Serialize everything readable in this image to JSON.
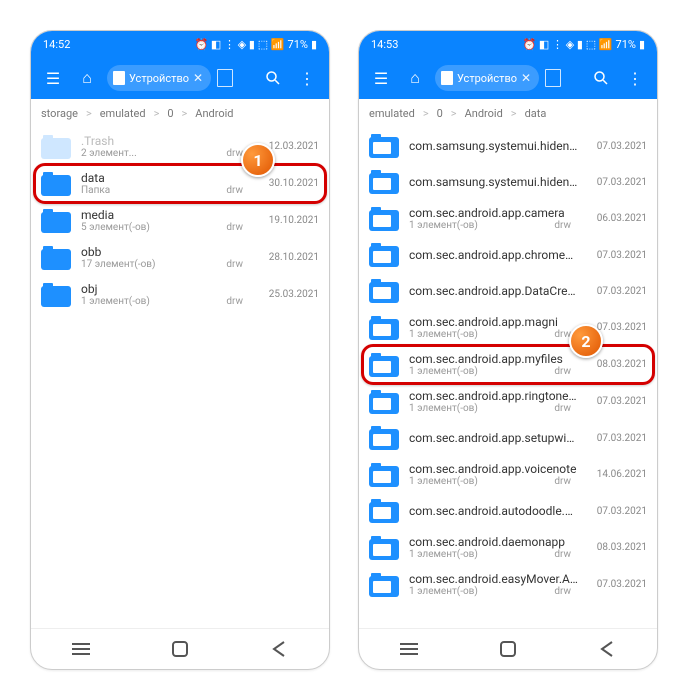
{
  "phone1": {
    "status": {
      "time": "14:52",
      "battery": "71%"
    },
    "tab_label": "Устройство",
    "crumbs": [
      "storage",
      "emulated",
      "0",
      "Android"
    ],
    "rows": [
      {
        "name": ".Trash",
        "sub": "2 элемент...",
        "perm": "drw",
        "date": "12.03.2021",
        "dim": true
      },
      {
        "name": "data",
        "sub": "Папка",
        "perm": "drw",
        "date": "30.10.2021",
        "hl": true
      },
      {
        "name": "media",
        "sub": "5 элемент(-ов)",
        "perm": "drw",
        "date": "19.10.2021"
      },
      {
        "name": "obb",
        "sub": "17 элемент(-ов)",
        "perm": "drw",
        "date": "28.10.2021"
      },
      {
        "name": "obj",
        "sub": "1 элемент(-ов)",
        "perm": "drw",
        "date": "25.03.2021"
      }
    ],
    "callout": "1"
  },
  "phone2": {
    "status": {
      "time": "14:53",
      "battery": "71%"
    },
    "tab_label": "Устройство",
    "crumbs": [
      "emulated",
      "0",
      "Android",
      "data"
    ],
    "rows": [
      {
        "name": "com.samsung.systemui.hidenotch",
        "sub": "",
        "perm": "",
        "date": "07.03.2021",
        "icon": "doc"
      },
      {
        "name": "com.samsung.systemui.hidenotch.withoutcornerround",
        "sub": "",
        "perm": "",
        "date": "07.03.2021",
        "icon": "doc"
      },
      {
        "name": "com.sec.android.app.camera",
        "sub": "1 элемент(-ов)",
        "perm": "drw",
        "date": "06.03.2021",
        "icon": "doc"
      },
      {
        "name": "com.sec.android.app.chromecustomizations",
        "sub": "",
        "perm": "",
        "date": "07.03.2021",
        "icon": "doc"
      },
      {
        "name": "com.sec.android.app.DataCreate",
        "sub": "",
        "perm": "",
        "date": "07.03.2021",
        "icon": "doc"
      },
      {
        "name": "com.sec.android.app.magni",
        "sub": "1 элемент(-ов)",
        "perm": "drw",
        "date": "07.03.2021",
        "icon": "doc"
      },
      {
        "name": "com.sec.android.app.myfiles",
        "sub": "1 элемент(-ов)",
        "perm": "drw",
        "date": "08.03.2021",
        "icon": "doc",
        "hl": true
      },
      {
        "name": "com.sec.android.app.ringtoneBR",
        "sub": "1 элемент(-ов)",
        "perm": "drw",
        "date": "07.03.2021",
        "icon": "doc"
      },
      {
        "name": "com.sec.android.app.setupwizardlegalprovider",
        "sub": "",
        "perm": "",
        "date": "07.03.2021",
        "icon": "doc"
      },
      {
        "name": "com.sec.android.app.voicenote",
        "sub": "1 элемент(-ов)",
        "perm": "drw",
        "date": "14.06.2021",
        "icon": "doc"
      },
      {
        "name": "com.sec.android.autodoodle.service",
        "sub": "",
        "perm": "",
        "date": "07.03.2021",
        "icon": "doc"
      },
      {
        "name": "com.sec.android.daemonapp",
        "sub": "1 элемент(-ов)",
        "perm": "drw",
        "date": "08.03.2021",
        "icon": "doc"
      },
      {
        "name": "com.sec.android.easyMover.Agent",
        "sub": "1 элемент(-ов)",
        "perm": "drw",
        "date": "07.03.2021",
        "icon": "doc"
      }
    ],
    "callout": "2"
  }
}
